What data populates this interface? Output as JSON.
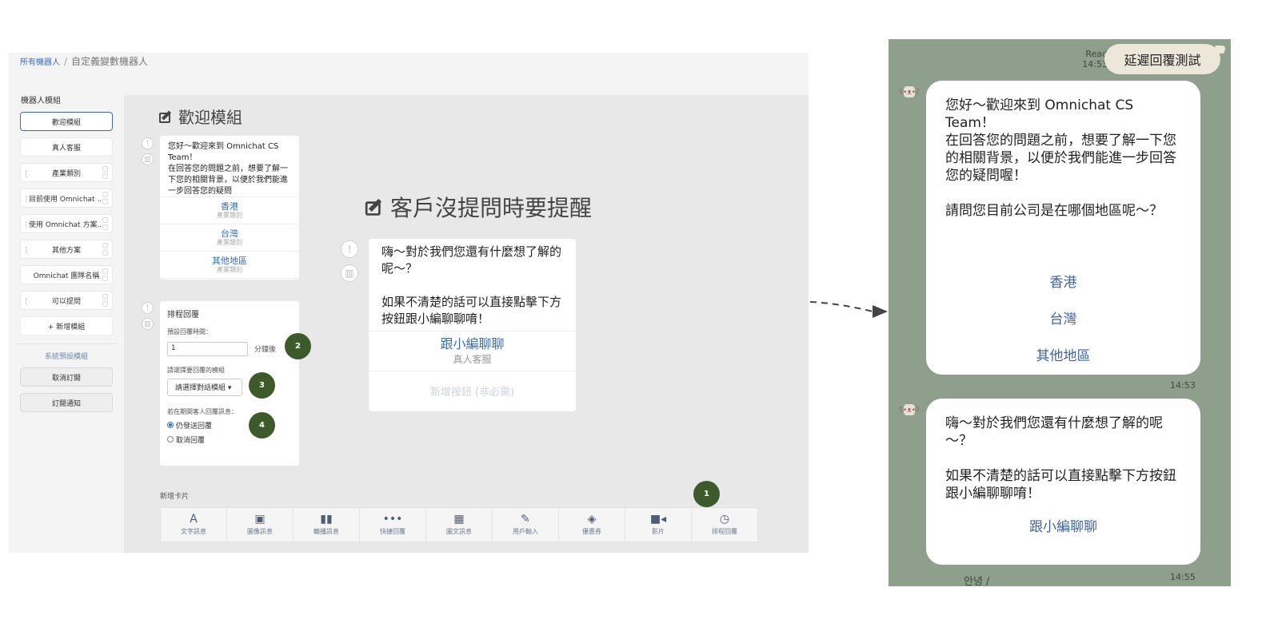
{
  "breadcrumb": {
    "root": "所有機器人",
    "separator": "/",
    "current": "自定義變數機器人"
  },
  "sidebar": {
    "section_title": "機器人模組",
    "items": [
      {
        "label": "歡迎模組",
        "active": true
      },
      {
        "label": "真人客服"
      },
      {
        "label": "產業類別"
      },
      {
        "label": "目前使用 Omnichat ..."
      },
      {
        "label": "使用 Omnichat 方案..."
      },
      {
        "label": "其他方案"
      },
      {
        "label": "Omnichat 團隊名稱"
      },
      {
        "label": "可以提問"
      }
    ],
    "add_label": "+ 新增模組",
    "system_title": "系統預設模組",
    "system_items": [
      {
        "label": "取消訂閱"
      },
      {
        "label": "訂閱通知"
      }
    ]
  },
  "editor": {
    "title": "歡迎模組",
    "welcome_text": "您好～歡迎來到 Omnichat CS Team！\n在回答您的問題之前，想要了解一下您的相關背景，以便於我們能進一步回答您的疑問",
    "quick_replies": [
      {
        "label": "香港",
        "sub": "產業類別"
      },
      {
        "label": "台灣",
        "sub": "產業類別"
      },
      {
        "label": "其他地區",
        "sub": "產業類別"
      }
    ],
    "schedule": {
      "title": "排程回覆",
      "delay_label": "預設回覆時間：",
      "delay_value": "1",
      "delay_unit": "分鐘後",
      "module_label": "請選擇要回覆的模組",
      "module_placeholder": "請選擇對話模組 ▾",
      "during_label": "若在期間客人回覆訊息：",
      "option_send": "仍發送回覆",
      "option_cancel": "取消回覆"
    },
    "add_card_label": "新增卡片",
    "toolbar": [
      {
        "glyph": "A",
        "label": "文字訊息",
        "icon": "text-icon"
      },
      {
        "glyph": "▣",
        "label": "圖像訊息",
        "icon": "image-icon"
      },
      {
        "glyph": "▮▮",
        "label": "輪播訊息",
        "icon": "carousel-icon"
      },
      {
        "glyph": "•••",
        "label": "快捷回覆",
        "icon": "quick-reply-icon"
      },
      {
        "glyph": "▦",
        "label": "圖文訊息",
        "icon": "imagemap-icon"
      },
      {
        "glyph": "✎",
        "label": "用戶輸入",
        "icon": "user-input-icon"
      },
      {
        "glyph": "◈",
        "label": "優惠券",
        "icon": "coupon-icon"
      },
      {
        "glyph": "■◂",
        "label": "影片",
        "icon": "video-icon"
      },
      {
        "glyph": "◷",
        "label": "排程回覆",
        "icon": "clock-icon"
      }
    ],
    "badges": [
      "1",
      "2",
      "3",
      "4"
    ]
  },
  "reminder": {
    "title": "客戶沒提問時要提醒",
    "text": "嗨～對於我們您還有什麼想了解的呢～？\n\n如果不清楚的話可以直接點擊下方按鈕跟小編聊聊唷！",
    "button_label": "跟小編聊聊",
    "button_sub": "真人客服",
    "add_button": "新增按鈕 (非必需)"
  },
  "chat": {
    "read_label": "Read",
    "read_time": "14:53",
    "sent_message": "延遲回覆測試",
    "bubble1_text": "您好～歡迎來到 Omnichat CS Team！\n在回答您的問題之前，想要了解一下您的相關背景，以便於我們能進一步回答您的疑問喔！\n\n請問您目前公司是在哪個地區呢～？",
    "bubble1_buttons": [
      "香港",
      "台灣",
      "其他地區"
    ],
    "bubble1_time": "14:53",
    "bubble2_text": "嗨～對於我們您還有什麼想了解的呢～？\n\n如果不清楚的話可以直接點擊下方按鈕跟小編聊聊唷！",
    "bubble2_button": "跟小編聊聊",
    "bubble2_time": "14:55",
    "bottom_hint": "안녕 /"
  },
  "colors": {
    "accent": "#3b6db5",
    "badge": "#3d5a2b",
    "chat_bg": "#8e9f8c",
    "sent_bubble": "#ede7d9"
  }
}
